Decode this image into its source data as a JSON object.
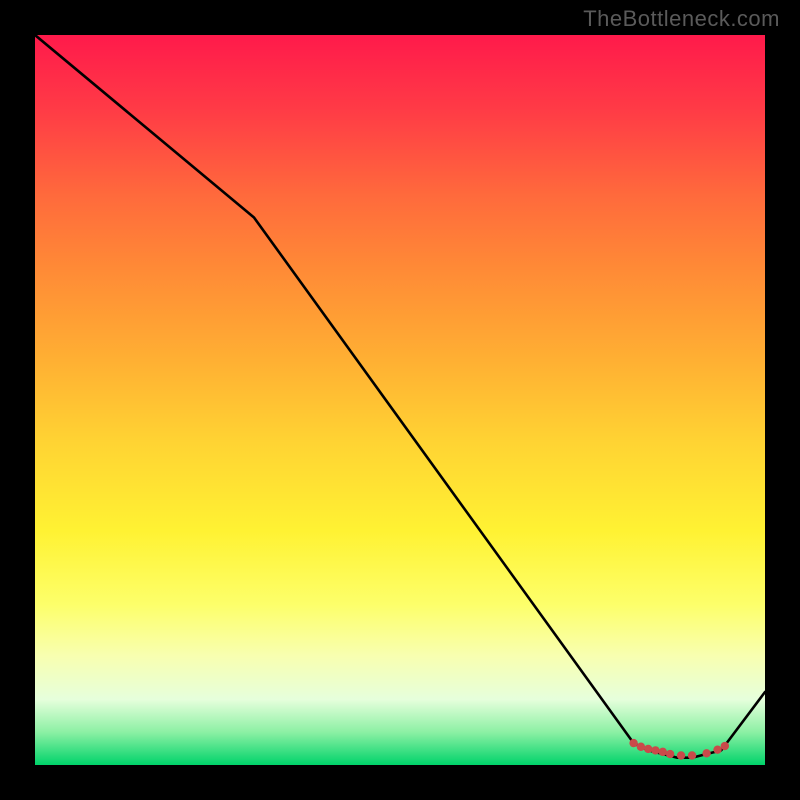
{
  "watermark": "TheBottleneck.com",
  "chart_data": {
    "type": "line",
    "title": "",
    "xlabel": "",
    "ylabel": "",
    "xlim": [
      0,
      100
    ],
    "ylim": [
      0,
      100
    ],
    "series": [
      {
        "name": "curve",
        "x": [
          0,
          30,
          82,
          84,
          86,
          88,
          90,
          92,
          94,
          100
        ],
        "y": [
          100,
          75,
          3,
          2,
          1.5,
          1,
          1,
          1.5,
          2,
          10
        ]
      }
    ],
    "markers": {
      "name": "dots",
      "color": "#c94a4a",
      "points": [
        {
          "x": 82,
          "y": 3
        },
        {
          "x": 83,
          "y": 2.5
        },
        {
          "x": 84,
          "y": 2.2
        },
        {
          "x": 85,
          "y": 2.0
        },
        {
          "x": 86,
          "y": 1.8
        },
        {
          "x": 87,
          "y": 1.5
        },
        {
          "x": 88.5,
          "y": 1.3
        },
        {
          "x": 90,
          "y": 1.3
        },
        {
          "x": 92,
          "y": 1.6
        },
        {
          "x": 93.5,
          "y": 2.1
        },
        {
          "x": 94.5,
          "y": 2.6
        }
      ]
    },
    "background": {
      "type": "vertical-gradient",
      "stops": [
        {
          "pos": 0.0,
          "color": "#ff1a4b"
        },
        {
          "pos": 0.5,
          "color": "#ffd433"
        },
        {
          "pos": 0.9,
          "color": "#f8ffb0"
        },
        {
          "pos": 1.0,
          "color": "#00d36a"
        }
      ]
    }
  }
}
